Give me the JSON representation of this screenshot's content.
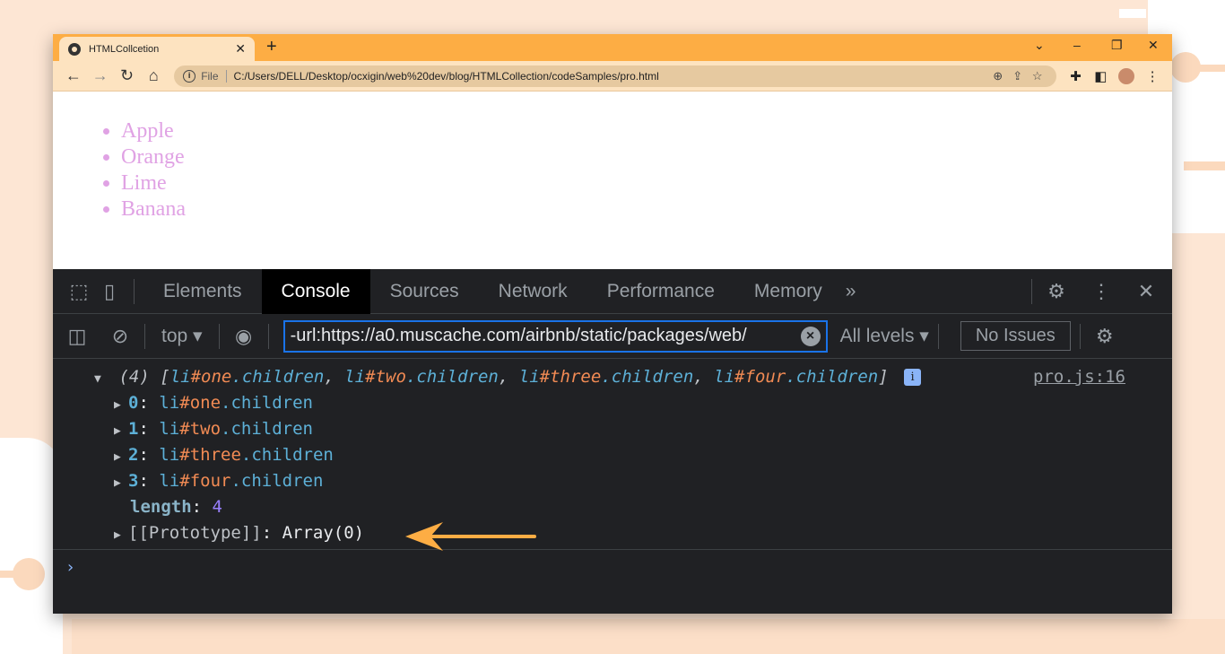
{
  "browser": {
    "tab_title": "HTMLCollcetion",
    "new_tab": "+",
    "url_scheme_label": "File",
    "url": "C:/Users/DELL/Desktop/ocxigin/web%20dev/blog/HTMLCollection/codeSamples/pro.html"
  },
  "page": {
    "list_items": [
      "Apple",
      "Orange",
      "Lime",
      "Banana"
    ]
  },
  "devtools": {
    "tabs": [
      "Elements",
      "Console",
      "Sources",
      "Network",
      "Performance",
      "Memory"
    ],
    "active_tab": "Console",
    "more_tabs": "»",
    "context": "top",
    "filter_value": "-url:https://a0.muscache.com/airbnb/static/packages/web/",
    "levels": "All levels",
    "issues": "No Issues"
  },
  "console": {
    "summary_count": "(4)",
    "summary_items": [
      {
        "tag": "li",
        "id": "one",
        "prop": "children"
      },
      {
        "tag": "li",
        "id": "two",
        "prop": "children"
      },
      {
        "tag": "li",
        "id": "three",
        "prop": "children"
      },
      {
        "tag": "li",
        "id": "four",
        "prop": "children"
      }
    ],
    "source": "pro.js:16",
    "entries": [
      {
        "index": "0",
        "tag": "li",
        "id": "one",
        "prop": "children"
      },
      {
        "index": "1",
        "tag": "li",
        "id": "two",
        "prop": "children"
      },
      {
        "index": "2",
        "tag": "li",
        "id": "three",
        "prop": "children"
      },
      {
        "index": "3",
        "tag": "li",
        "id": "four",
        "prop": "children"
      }
    ],
    "length_key": "length",
    "length_value": "4",
    "prototype_key": "[[Prototype]]",
    "prototype_value": "Array(0)"
  },
  "colors": {
    "titlebar": "#fdad44",
    "list_text": "#e0a2e4",
    "arrow": "#fdad44"
  }
}
